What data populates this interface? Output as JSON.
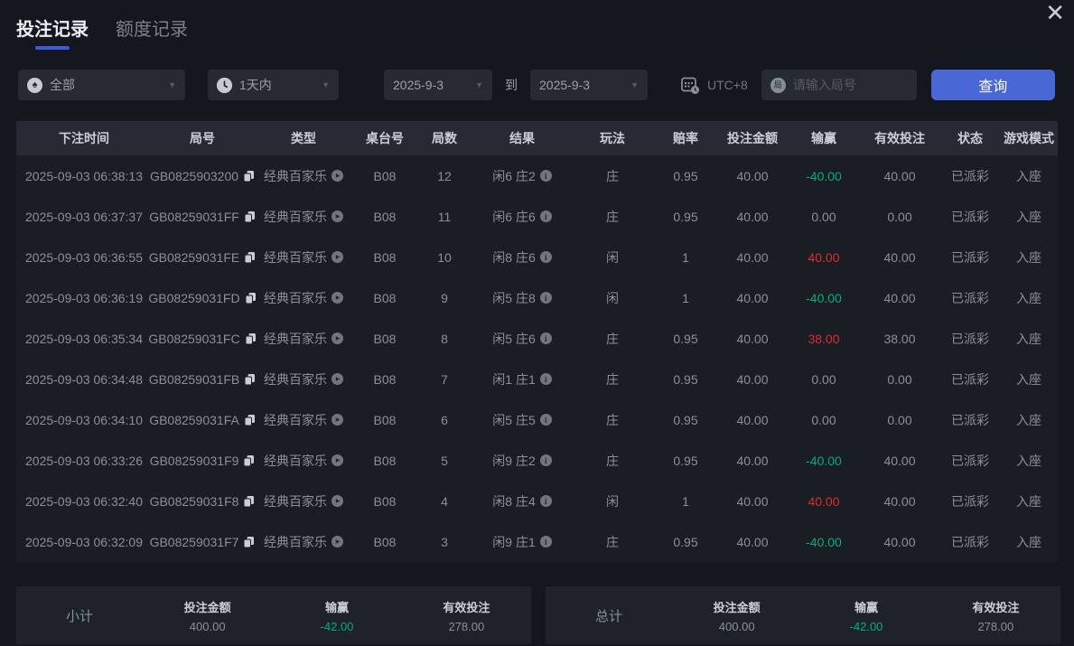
{
  "tabs": [
    {
      "label": "投注记录",
      "active": true
    },
    {
      "label": "额度记录",
      "active": false
    }
  ],
  "filters": {
    "game_type_value": "全部",
    "time_range_value": "1天内",
    "date_from": "2025-9-3",
    "to_label": "到",
    "date_to": "2025-9-3",
    "timezone": "UTC+8",
    "round_input_placeholder": "请输入局号",
    "round_input_value": "",
    "query_label": "查询"
  },
  "table": {
    "columns": [
      "下注时间",
      "局号",
      "类型",
      "桌台号",
      "局数",
      "结果",
      "玩法",
      "赔率",
      "投注金额",
      "输赢",
      "有效投注",
      "状态",
      "游戏模式"
    ],
    "rows": [
      {
        "time": "2025-09-03 06:38:13",
        "round_id": "GB0825903200",
        "type": "经典百家乐",
        "table_no": "B08",
        "round": "12",
        "result": "闲6 庄2",
        "play": "庄",
        "odds": "0.95",
        "bet": "40.00",
        "win": "-40.00",
        "valid": "40.00",
        "status": "已派彩",
        "mode": "入座"
      },
      {
        "time": "2025-09-03 06:37:37",
        "round_id": "GB08259031FF",
        "type": "经典百家乐",
        "table_no": "B08",
        "round": "11",
        "result": "闲6 庄6",
        "play": "庄",
        "odds": "0.95",
        "bet": "40.00",
        "win": "0.00",
        "valid": "0.00",
        "status": "已派彩",
        "mode": "入座"
      },
      {
        "time": "2025-09-03 06:36:55",
        "round_id": "GB08259031FE",
        "type": "经典百家乐",
        "table_no": "B08",
        "round": "10",
        "result": "闲8 庄6",
        "play": "闲",
        "odds": "1",
        "bet": "40.00",
        "win": "40.00",
        "valid": "40.00",
        "status": "已派彩",
        "mode": "入座"
      },
      {
        "time": "2025-09-03 06:36:19",
        "round_id": "GB08259031FD",
        "type": "经典百家乐",
        "table_no": "B08",
        "round": "9",
        "result": "闲5 庄8",
        "play": "闲",
        "odds": "1",
        "bet": "40.00",
        "win": "-40.00",
        "valid": "40.00",
        "status": "已派彩",
        "mode": "入座"
      },
      {
        "time": "2025-09-03 06:35:34",
        "round_id": "GB08259031FC",
        "type": "经典百家乐",
        "table_no": "B08",
        "round": "8",
        "result": "闲5 庄6",
        "play": "庄",
        "odds": "0.95",
        "bet": "40.00",
        "win": "38.00",
        "valid": "38.00",
        "status": "已派彩",
        "mode": "入座"
      },
      {
        "time": "2025-09-03 06:34:48",
        "round_id": "GB08259031FB",
        "type": "经典百家乐",
        "table_no": "B08",
        "round": "7",
        "result": "闲1 庄1",
        "play": "庄",
        "odds": "0.95",
        "bet": "40.00",
        "win": "0.00",
        "valid": "0.00",
        "status": "已派彩",
        "mode": "入座"
      },
      {
        "time": "2025-09-03 06:34:10",
        "round_id": "GB08259031FA",
        "type": "经典百家乐",
        "table_no": "B08",
        "round": "6",
        "result": "闲5 庄5",
        "play": "庄",
        "odds": "0.95",
        "bet": "40.00",
        "win": "0.00",
        "valid": "0.00",
        "status": "已派彩",
        "mode": "入座"
      },
      {
        "time": "2025-09-03 06:33:26",
        "round_id": "GB08259031F9",
        "type": "经典百家乐",
        "table_no": "B08",
        "round": "5",
        "result": "闲9 庄2",
        "play": "庄",
        "odds": "0.95",
        "bet": "40.00",
        "win": "-40.00",
        "valid": "40.00",
        "status": "已派彩",
        "mode": "入座"
      },
      {
        "time": "2025-09-03 06:32:40",
        "round_id": "GB08259031F8",
        "type": "经典百家乐",
        "table_no": "B08",
        "round": "4",
        "result": "闲8 庄4",
        "play": "闲",
        "odds": "1",
        "bet": "40.00",
        "win": "40.00",
        "valid": "40.00",
        "status": "已派彩",
        "mode": "入座"
      },
      {
        "time": "2025-09-03 06:32:09",
        "round_id": "GB08259031F7",
        "type": "经典百家乐",
        "table_no": "B08",
        "round": "3",
        "result": "闲9 庄1",
        "play": "庄",
        "odds": "0.95",
        "bet": "40.00",
        "win": "-40.00",
        "valid": "40.00",
        "status": "已派彩",
        "mode": "入座"
      }
    ]
  },
  "summary": {
    "subtotal": {
      "label": "小计",
      "bet_label": "投注金额",
      "bet": "400.00",
      "win_label": "输赢",
      "win": "-42.00",
      "valid_label": "有效投注",
      "valid": "278.00"
    },
    "total": {
      "label": "总计",
      "bet_label": "投注金额",
      "bet": "400.00",
      "win_label": "输赢",
      "win": "-42.00",
      "valid_label": "有效投注",
      "valid": "278.00"
    }
  },
  "icons": {
    "close": "✕",
    "chevron": "▼",
    "spade": "♠",
    "round_badge": "局",
    "info": "i",
    "play": "▶"
  },
  "colors": {
    "accent_blue": "#4a67d6",
    "tab_underline": "#3c5be0",
    "negative_green": "#00b173",
    "positive_red": "#dd2c2c"
  }
}
